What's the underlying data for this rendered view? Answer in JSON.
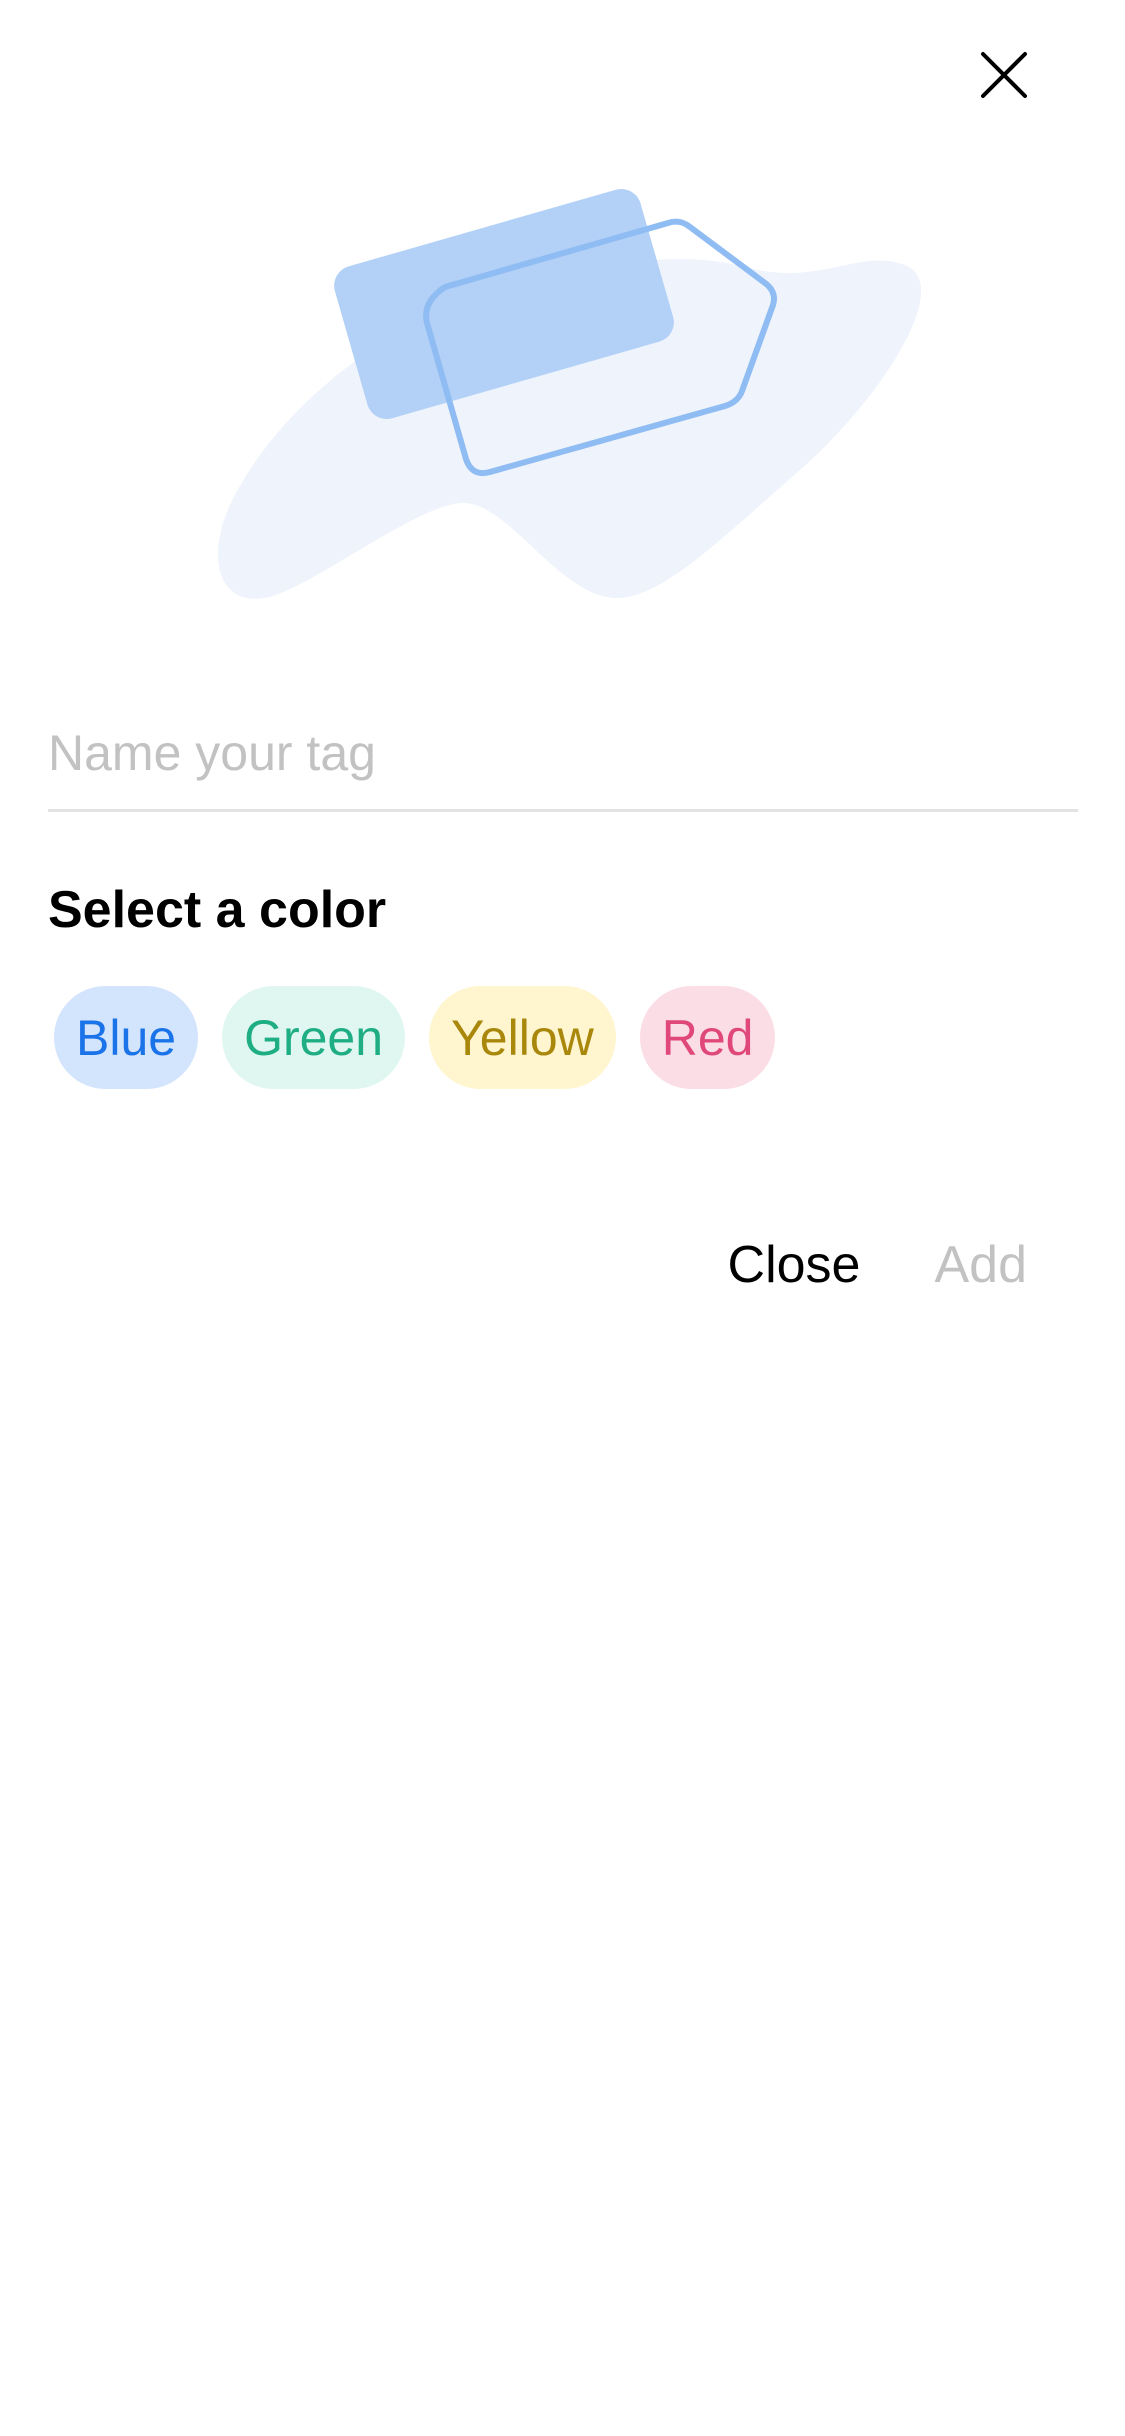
{
  "dialog": {
    "name_field": {
      "value": "",
      "placeholder": "Name your tag"
    },
    "color_section": {
      "heading": "Select a color",
      "options": [
        {
          "label": "Blue",
          "bg": "#d3e4fd",
          "text": "#1a73e8"
        },
        {
          "label": "Green",
          "bg": "#dff7f0",
          "text": "#1fae84"
        },
        {
          "label": "Yellow",
          "bg": "#fff5cf",
          "text": "#a8870a"
        },
        {
          "label": "Red",
          "bg": "#fbdde6",
          "text": "#e0477a"
        }
      ]
    },
    "actions": {
      "close_label": "Close",
      "add_label": "Add"
    },
    "icons": {
      "dismiss": "close-icon",
      "hero": "tag-illustration"
    },
    "colors": {
      "illustration_fill": "#b3d1f7",
      "illustration_stroke": "#8fbcf2",
      "illustration_blob": "#eff4fc",
      "divider": "#e3e3e3",
      "disabled_text": "#c2c2c2"
    }
  }
}
